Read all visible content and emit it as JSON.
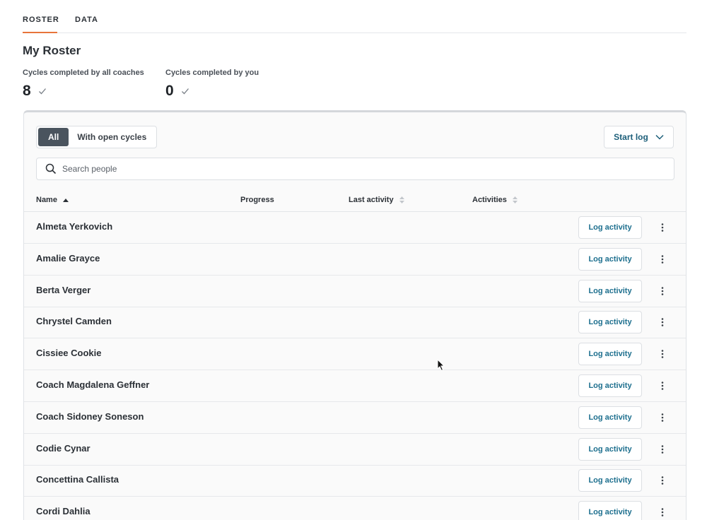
{
  "tabs": [
    {
      "label": "ROSTER",
      "active": true
    },
    {
      "label": "DATA",
      "active": false
    }
  ],
  "page_title": "My Roster",
  "stats": [
    {
      "label": "Cycles completed by all coaches",
      "value": "8",
      "icon": "check-icon"
    },
    {
      "label": "Cycles completed by you",
      "value": "0",
      "icon": "check-icon"
    }
  ],
  "filter": {
    "all_label": "All",
    "open_cycles_label": "With open cycles",
    "selected": "All"
  },
  "start_log_label": "Start log",
  "search": {
    "placeholder": "Search people",
    "value": ""
  },
  "table": {
    "columns": {
      "name": "Name",
      "progress": "Progress",
      "last_activity": "Last activity",
      "activities": "Activities"
    },
    "sort": {
      "column": "Name",
      "direction": "ascending"
    },
    "row_action_label": "Log activity",
    "rows": [
      {
        "name": "Almeta Yerkovich"
      },
      {
        "name": "Amalie Grayce"
      },
      {
        "name": "Berta Verger"
      },
      {
        "name": "Chrystel Camden"
      },
      {
        "name": "Cissiee Cookie"
      },
      {
        "name": "Coach Magdalena Geffner"
      },
      {
        "name": "Coach Sidoney Soneson"
      },
      {
        "name": "Codie Cynar"
      },
      {
        "name": "Concettina Callista"
      },
      {
        "name": "Cordi Dahlia"
      }
    ]
  },
  "colors": {
    "accent_tab_underline": "#e8743b",
    "link_blue": "#1d6f8e",
    "segment_active_bg": "#4a545e"
  }
}
